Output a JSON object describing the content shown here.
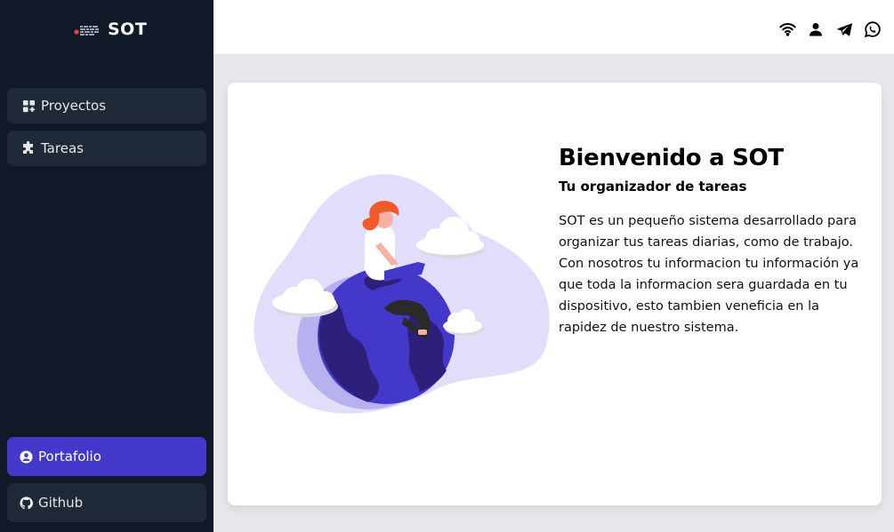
{
  "app": {
    "name": "SOT"
  },
  "sidebar": {
    "items": [
      {
        "label": "Proyectos",
        "icon": "projects-icon"
      },
      {
        "label": "Tareas",
        "icon": "puzzle-icon"
      }
    ],
    "bottom": [
      {
        "label": "Portafolio",
        "icon": "user-circle-icon",
        "active": true
      },
      {
        "label": "Github",
        "icon": "github-icon"
      }
    ]
  },
  "header": {
    "icons": [
      "wifi-icon",
      "user-icon",
      "telegram-icon",
      "whatsapp-icon"
    ]
  },
  "main": {
    "title": "Bienvenido a SOT",
    "subtitle": "Tu organizador de tareas",
    "description": "SOT es un pequeño sistema desarrollado para organizar tus tareas diarias, como de trabajo. Con nosotros tu informacion tu información ya que toda la informacion sera guardada en tu dispositivo, esto tambien veneficia en la rapidez de nuestro sistema."
  },
  "colors": {
    "sidebar_bg": "#111827",
    "nav_item_bg": "#1f2937",
    "accent": "#4338ca",
    "page_bg": "#e5e7eb"
  }
}
